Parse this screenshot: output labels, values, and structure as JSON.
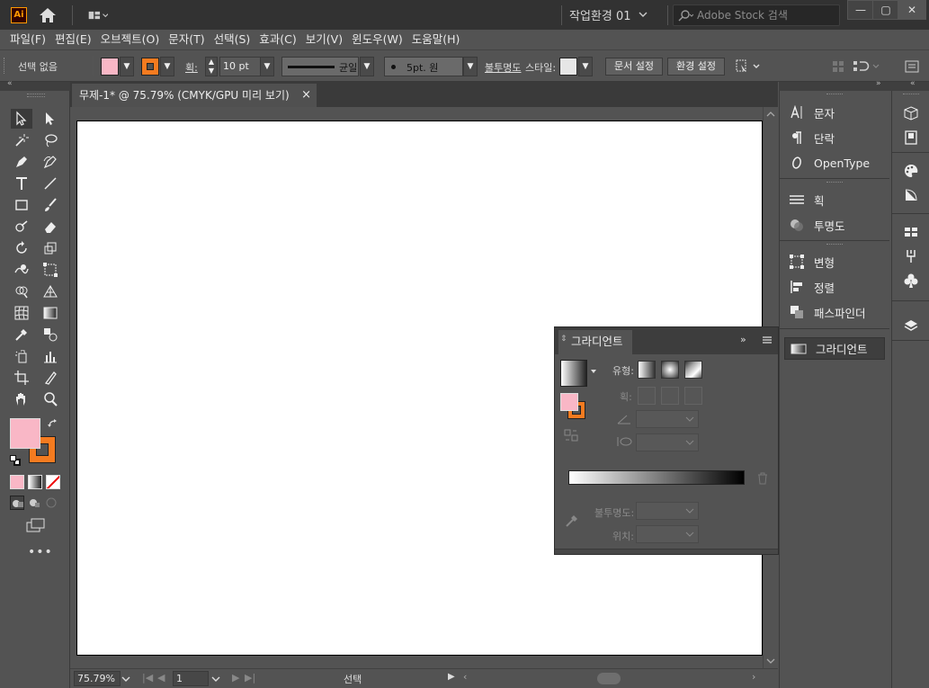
{
  "app": {
    "logo": "Ai",
    "workspace": "작업환경 01",
    "search_placeholder": "Adobe Stock 검색"
  },
  "menu": [
    "파일(F)",
    "편집(E)",
    "오브젝트(O)",
    "문자(T)",
    "선택(S)",
    "효과(C)",
    "보기(V)",
    "윈도우(W)",
    "도움말(H)"
  ],
  "control": {
    "selection": "선택 없음",
    "stroke_label": "획:",
    "stroke_value": "10 pt",
    "stroke_style": "균일",
    "brush": "5pt. 원",
    "opacity_label": "불투명도",
    "style_label": "스타일:",
    "doc_setup": "문서 설정",
    "prefs": "환경 설정"
  },
  "document": {
    "tab_title": "무제-1* @ 75.79% (CMYK/GPU 미리 보기)",
    "close": "×"
  },
  "status": {
    "zoom": "75.79%",
    "page": "1",
    "mode": "선택"
  },
  "panels": {
    "items": [
      {
        "label": "문자",
        "icon": "type-panel-icon"
      },
      {
        "label": "단락",
        "icon": "paragraph-icon"
      },
      {
        "label": "OpenType",
        "icon": "opentype-icon"
      },
      {
        "label": "획",
        "icon": "stroke-panel-icon"
      },
      {
        "label": "투명도",
        "icon": "transparency-icon"
      },
      {
        "label": "변형",
        "icon": "transform-icon"
      },
      {
        "label": "정렬",
        "icon": "align-icon"
      },
      {
        "label": "패스파인더",
        "icon": "pathfinder-icon"
      },
      {
        "label": "그라디언트",
        "icon": "gradient-panel-icon"
      }
    ]
  },
  "gradient_panel": {
    "title": "그라디언트",
    "type_label": "유형:",
    "stroke_label": "획:",
    "opacity_label": "불투명도:",
    "location_label": "위치:"
  },
  "colors": {
    "fill": "#f9b7c6",
    "stroke": "#f47b20",
    "artboard": "#ffffff",
    "ui_bg": "#535353"
  }
}
